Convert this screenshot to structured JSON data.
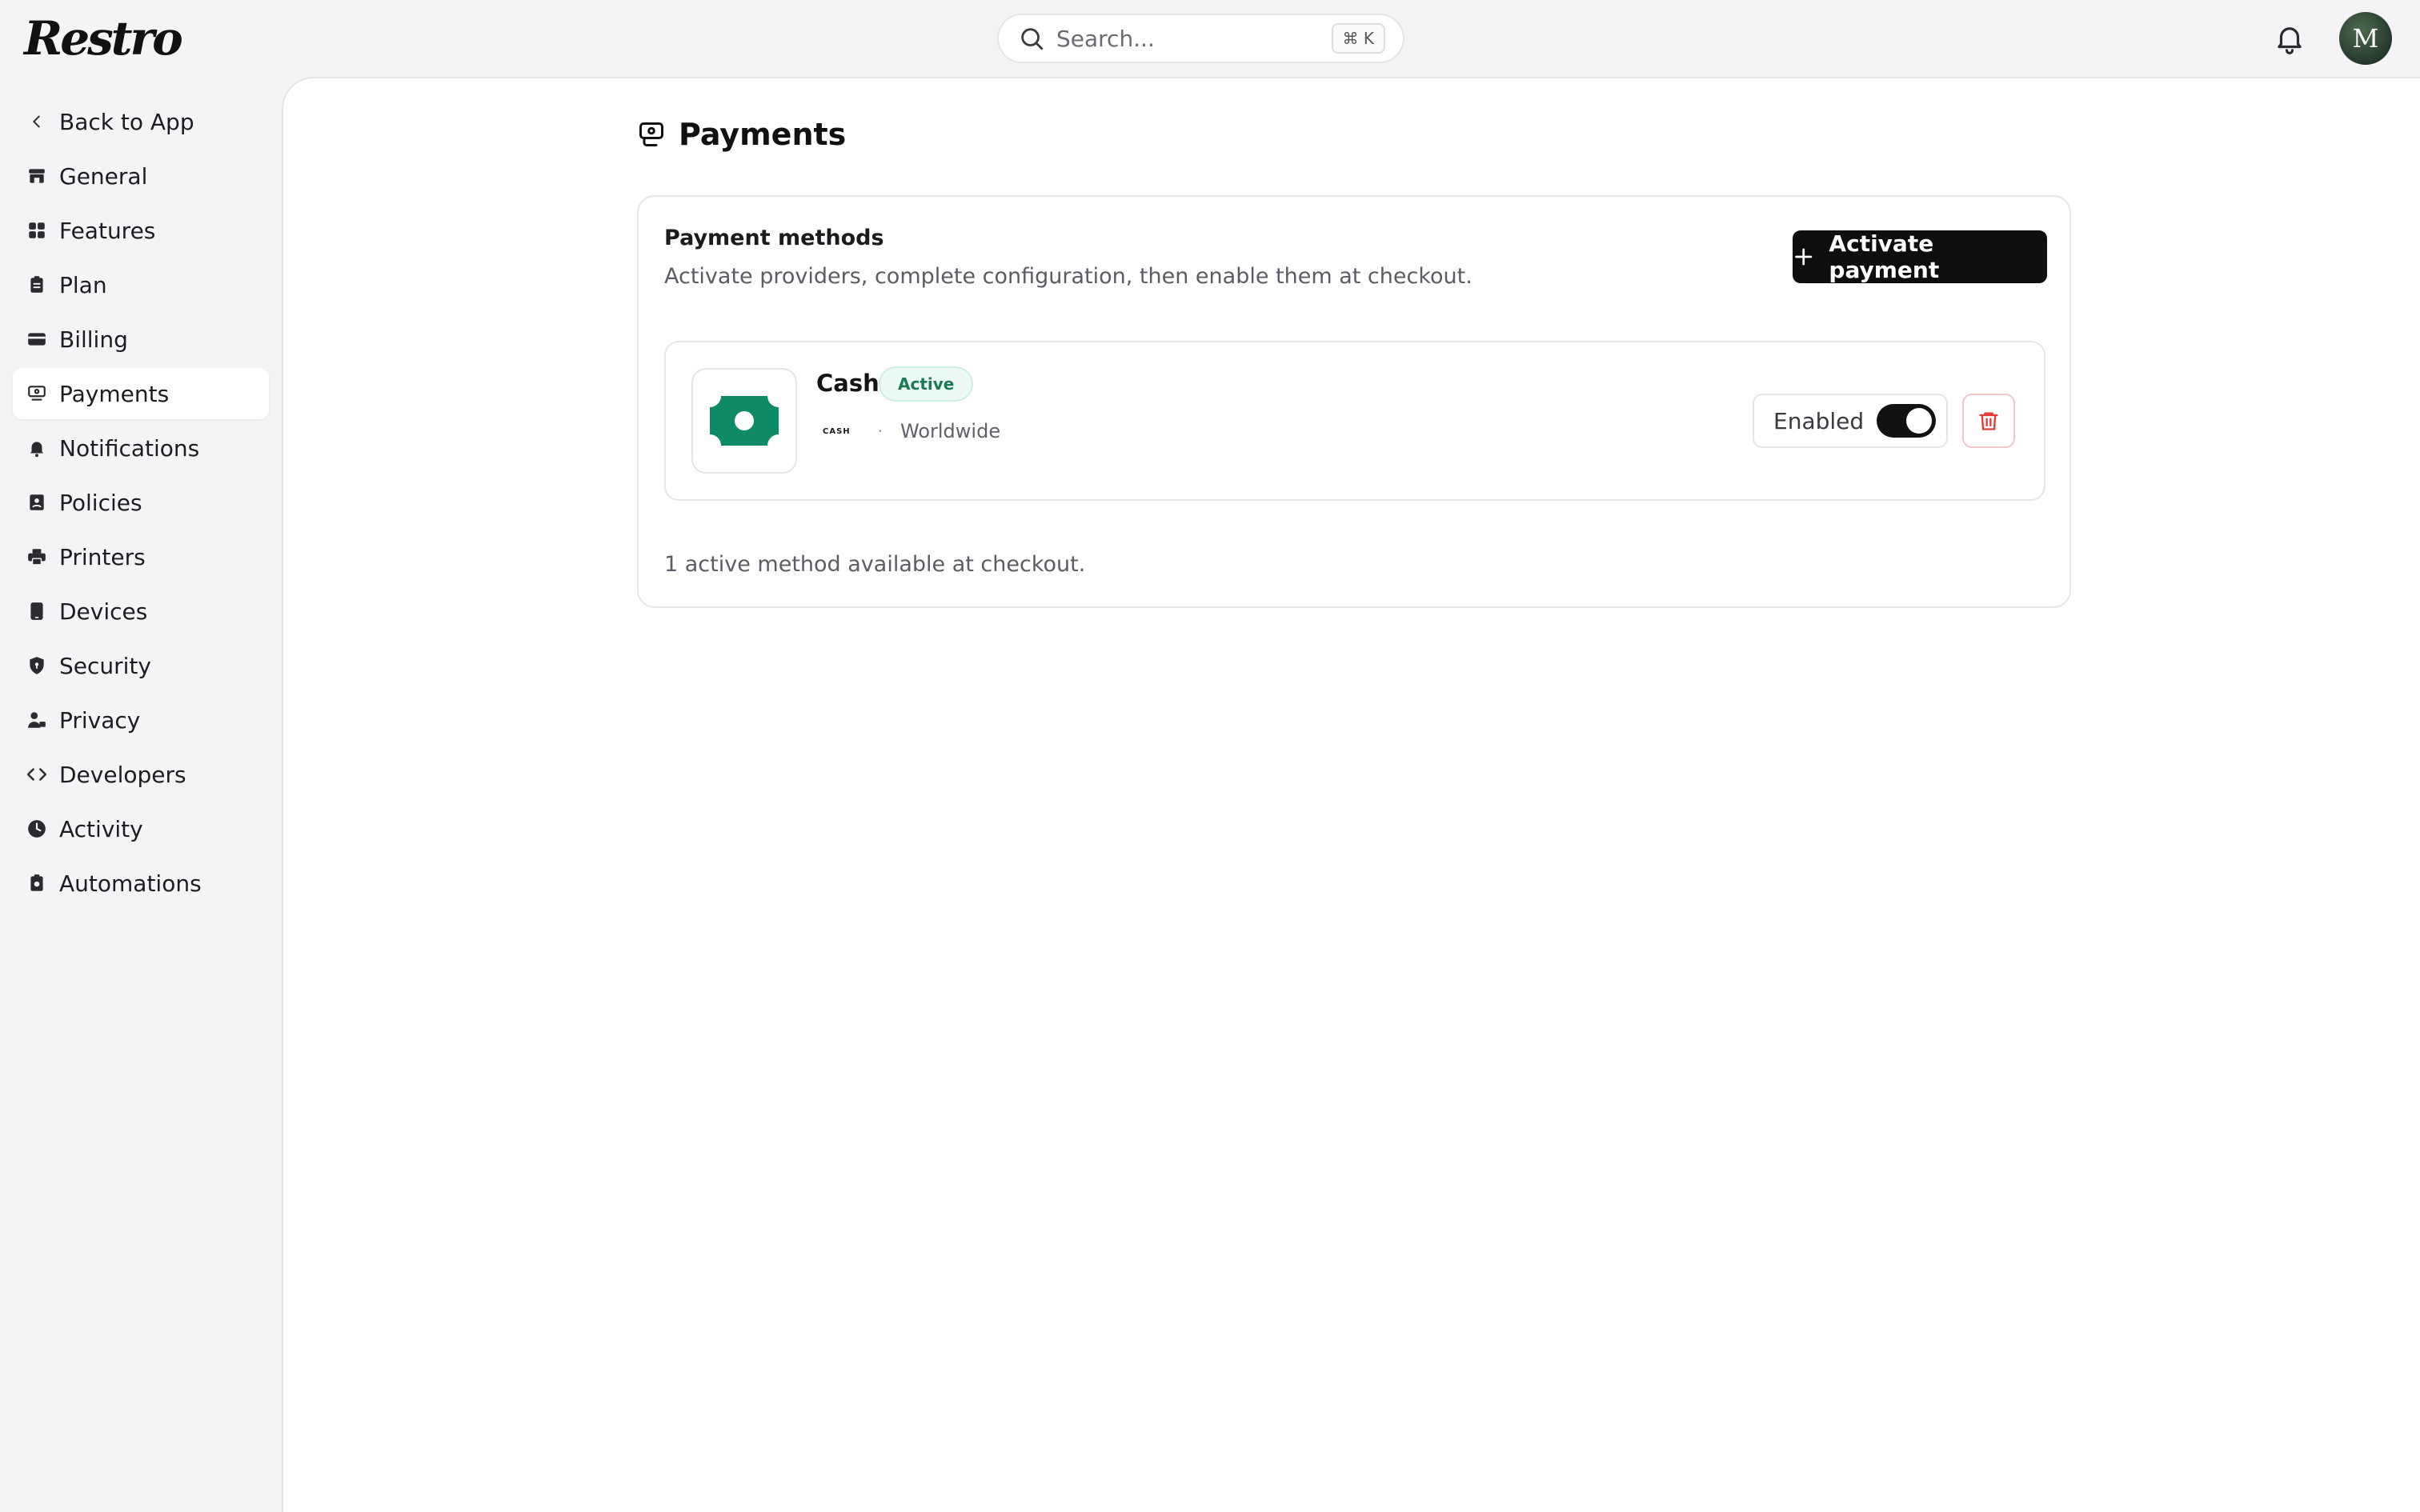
{
  "app": {
    "logo": "Restro"
  },
  "search": {
    "placeholder": "Search...",
    "shortcut": "⌘ K"
  },
  "user": {
    "avatar_initial": "M"
  },
  "sidebar": {
    "items": [
      {
        "label": "Back to App",
        "icon": "chevron-left-icon"
      },
      {
        "label": "General",
        "icon": "store-icon"
      },
      {
        "label": "Features",
        "icon": "grid-icon"
      },
      {
        "label": "Plan",
        "icon": "clipboard-icon"
      },
      {
        "label": "Billing",
        "icon": "credit-card-icon"
      },
      {
        "label": "Payments",
        "icon": "payments-icon",
        "active": true
      },
      {
        "label": "Notifications",
        "icon": "bell-icon"
      },
      {
        "label": "Policies",
        "icon": "policy-icon"
      },
      {
        "label": "Printers",
        "icon": "printer-icon"
      },
      {
        "label": "Devices",
        "icon": "tablet-icon"
      },
      {
        "label": "Security",
        "icon": "shield-icon"
      },
      {
        "label": "Privacy",
        "icon": "user-lock-icon"
      },
      {
        "label": "Developers",
        "icon": "code-icon"
      },
      {
        "label": "Activity",
        "icon": "clock-icon"
      },
      {
        "label": "Automations",
        "icon": "automation-icon"
      }
    ]
  },
  "page": {
    "title": "Payments"
  },
  "payment_methods": {
    "title": "Payment methods",
    "subtitle": "Activate providers, complete configuration, then enable them at checkout.",
    "activate_label": "Activate payment",
    "methods": [
      {
        "name": "Cash",
        "status": "Active",
        "tag": "CASH",
        "separator": "·",
        "region": "Worldwide",
        "enabled_label": "Enabled",
        "enabled": true,
        "icon": "banknote-icon"
      }
    ],
    "footer": "1 active method available at checkout."
  },
  "colors": {
    "accent": "#0e0e10",
    "status_active": "#1b7a55",
    "cash_green": "#0f8a66",
    "danger": "#e53935"
  }
}
